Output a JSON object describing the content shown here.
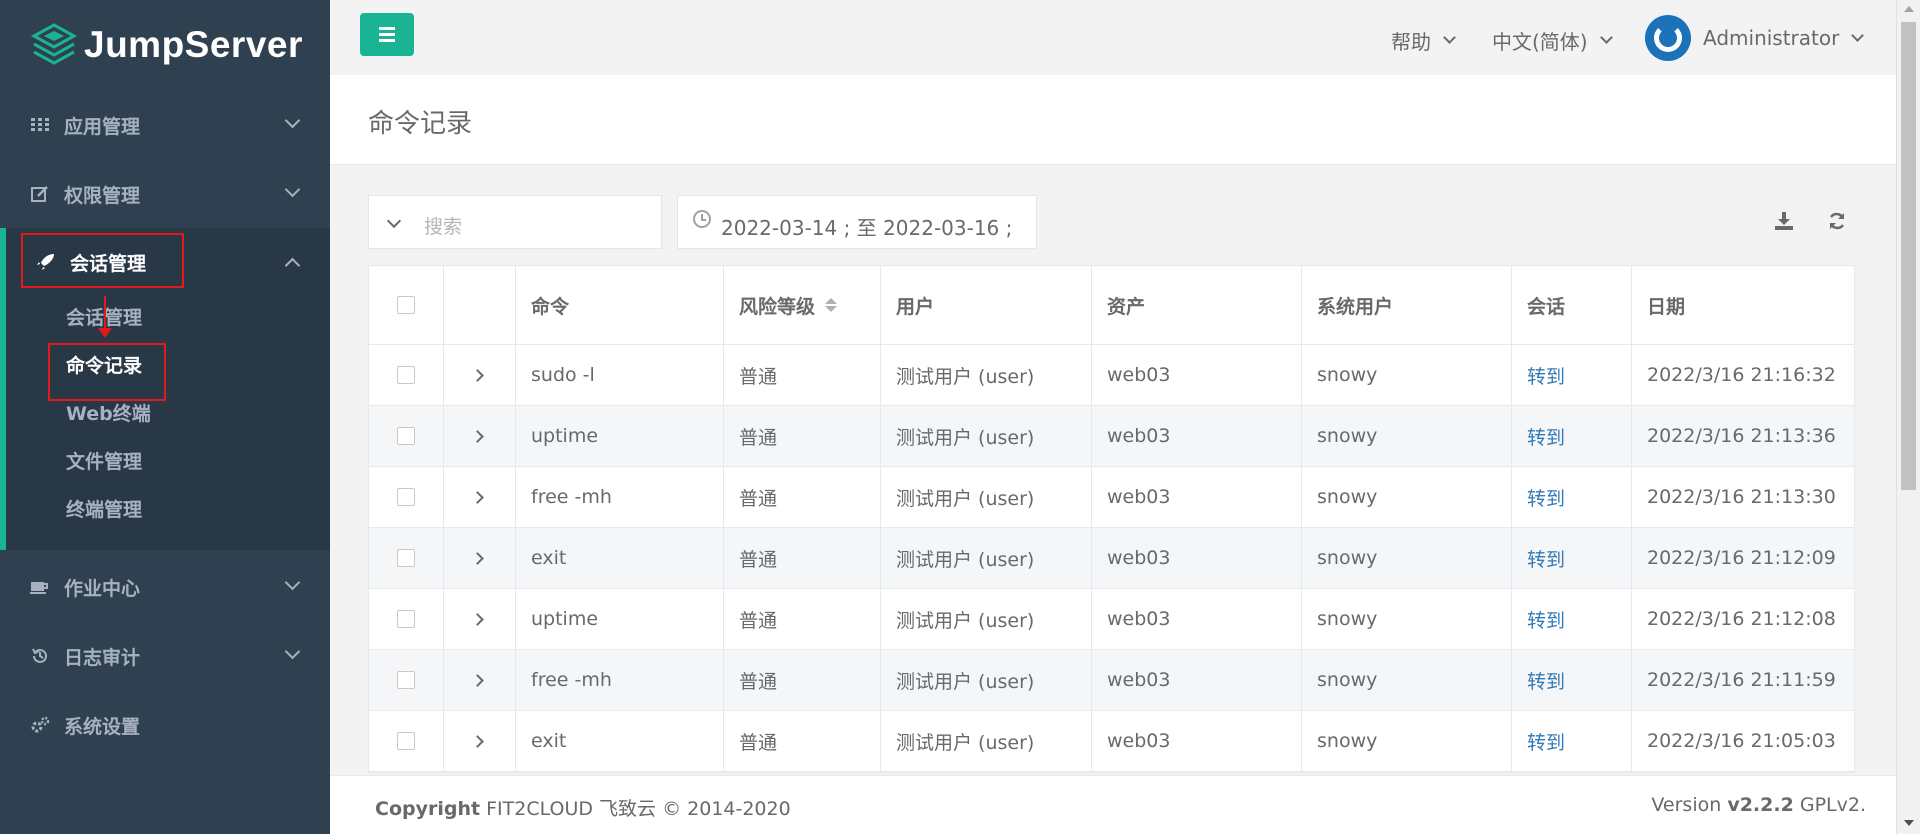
{
  "brand": {
    "name": "JumpServer",
    "accent": "#1ab394",
    "sidebar_bg": "#2f4050"
  },
  "sidebar": {
    "items": [
      {
        "label": "应用管理",
        "icon": "grid-icon"
      },
      {
        "label": "权限管理",
        "icon": "edit-icon"
      },
      {
        "label": "会话管理",
        "icon": "rocket-icon",
        "expanded": true
      },
      {
        "label": "作业中心",
        "icon": "coffee-icon"
      },
      {
        "label": "日志审计",
        "icon": "history-icon"
      },
      {
        "label": "系统设置",
        "icon": "gears-icon"
      }
    ],
    "session_sub": [
      "会话管理",
      "命令记录",
      "Web终端",
      "文件管理",
      "终端管理"
    ],
    "active_sub": "命令记录"
  },
  "topbar": {
    "help": "帮助",
    "language": "中文(简体)",
    "user": "Administrator"
  },
  "page": {
    "title": "命令记录"
  },
  "filters": {
    "search_placeholder": "搜索",
    "date_range": "2022-03-14 ; 至 2022-03-16 ;"
  },
  "table": {
    "headers": [
      "命令",
      "风险等级",
      "用户",
      "资产",
      "系统用户",
      "会话",
      "日期"
    ],
    "rows": [
      {
        "command": "sudo -l",
        "risk": "普通",
        "user": "测试用户 (user)",
        "asset": "web03",
        "system_user": "snowy",
        "session": "转到",
        "date": "2022/3/16 21:16:32"
      },
      {
        "command": "uptime",
        "risk": "普通",
        "user": "测试用户 (user)",
        "asset": "web03",
        "system_user": "snowy",
        "session": "转到",
        "date": "2022/3/16 21:13:36"
      },
      {
        "command": "free -mh",
        "risk": "普通",
        "user": "测试用户 (user)",
        "asset": "web03",
        "system_user": "snowy",
        "session": "转到",
        "date": "2022/3/16 21:13:30"
      },
      {
        "command": "exit",
        "risk": "普通",
        "user": "测试用户 (user)",
        "asset": "web03",
        "system_user": "snowy",
        "session": "转到",
        "date": "2022/3/16 21:12:09"
      },
      {
        "command": "uptime",
        "risk": "普通",
        "user": "测试用户 (user)",
        "asset": "web03",
        "system_user": "snowy",
        "session": "转到",
        "date": "2022/3/16 21:12:08"
      },
      {
        "command": "free -mh",
        "risk": "普通",
        "user": "测试用户 (user)",
        "asset": "web03",
        "system_user": "snowy",
        "session": "转到",
        "date": "2022/3/16 21:11:59"
      },
      {
        "command": "exit",
        "risk": "普通",
        "user": "测试用户 (user)",
        "asset": "web03",
        "system_user": "snowy",
        "session": "转到",
        "date": "2022/3/16 21:05:03"
      }
    ]
  },
  "footer": {
    "copyright_label": "Copyright",
    "copyright_text": "FIT2CLOUD 飞致云 © 2014-2020",
    "version_label": "Version",
    "version_number": "v2.2.2",
    "license": "GPLv2."
  }
}
